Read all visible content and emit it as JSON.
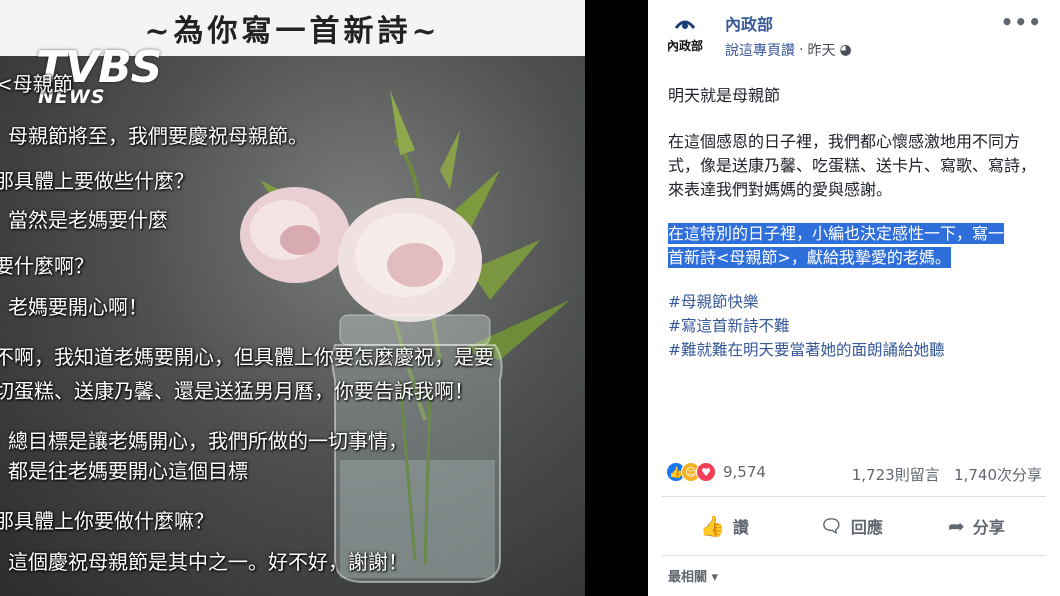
{
  "image": {
    "title": "~為你寫一首新詩~",
    "watermark": {
      "brand": "TVBS",
      "sub": "NEWS"
    },
    "poem_lines": [
      "<母親節",
      "母親節將至，我們要慶祝母親節。",
      "那具體上要做些什麼？",
      "當然是老媽要什麼",
      "要什麼啊？",
      "老媽要開心啊！",
      "不啊，我知道老媽要開心，但具體上你要怎麼慶祝，是要",
      "切蛋糕、送康乃馨、還是送猛男月曆，你要告訴我啊！",
      "總目標是讓老媽開心，我們所做的一切事情，",
      "都是往老媽要開心這個目標",
      "那具體上你要做什麼嘛？",
      "這個慶祝母親節是其中之一。好不好，謝謝！"
    ]
  },
  "post": {
    "page_name": "內政部",
    "avatar_text": "內政部",
    "meta_link": "說這專頁讚",
    "meta_time": "昨天",
    "intro": "明天就是母親節",
    "body": "在這個感恩的日子裡，我們都心懷感激地用不同方式，像是送康乃馨、吃蛋糕、送卡片、寫歌、寫詩，來表達我們對媽媽的愛與感謝。",
    "highlight_line1": "在這特別的日子裡，小編也決定感性一下，寫一",
    "highlight_line2": "首新詩<母親節>，獻給我摯愛的老媽。",
    "hashtags": [
      "#母親節快樂",
      "#寫這首新詩不難",
      "#難就難在明天要當著她的面朗誦給她聽"
    ],
    "reaction_count": "9,574",
    "comments": "1,723則留言",
    "shares": "1,740次分享",
    "actions": {
      "like": "讚",
      "comment": "回應",
      "share": "分享"
    },
    "comment_sort": "最相關"
  },
  "colors": {
    "link": "#385898",
    "highlight": "#2f6fdb",
    "like": "#1877f2",
    "haha": "#f7b125",
    "love": "#f33e58"
  }
}
